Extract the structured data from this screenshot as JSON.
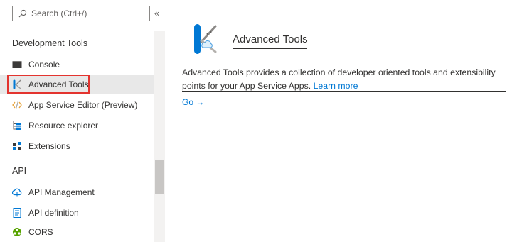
{
  "sidebar": {
    "search": {
      "placeholder": "Search (Ctrl+/)",
      "value": ""
    },
    "collapse_glyph": "«",
    "sections": [
      {
        "header": "Development Tools",
        "items": [
          {
            "label": "Console",
            "icon": "console-icon"
          },
          {
            "label": "Advanced Tools",
            "icon": "advanced-tools-icon",
            "selected": true
          },
          {
            "label": "App Service Editor (Preview)",
            "icon": "code-editor-icon"
          },
          {
            "label": "Resource explorer",
            "icon": "resource-explorer-icon"
          },
          {
            "label": "Extensions",
            "icon": "extensions-icon"
          }
        ]
      },
      {
        "header": "API",
        "items": [
          {
            "label": "API Management",
            "icon": "api-management-icon"
          },
          {
            "label": "API definition",
            "icon": "api-definition-icon"
          },
          {
            "label": "CORS",
            "icon": "cors-icon"
          }
        ]
      }
    ]
  },
  "main": {
    "title": "Advanced Tools",
    "description": "Advanced Tools provides a collection of developer oriented tools and extensibility points for your App Service Apps.",
    "learn_more": "Learn more",
    "go_link": "Go →"
  },
  "colors": {
    "accent": "#0078d4",
    "highlight": "#e3342f",
    "selected_bg": "#e8e8e8"
  }
}
